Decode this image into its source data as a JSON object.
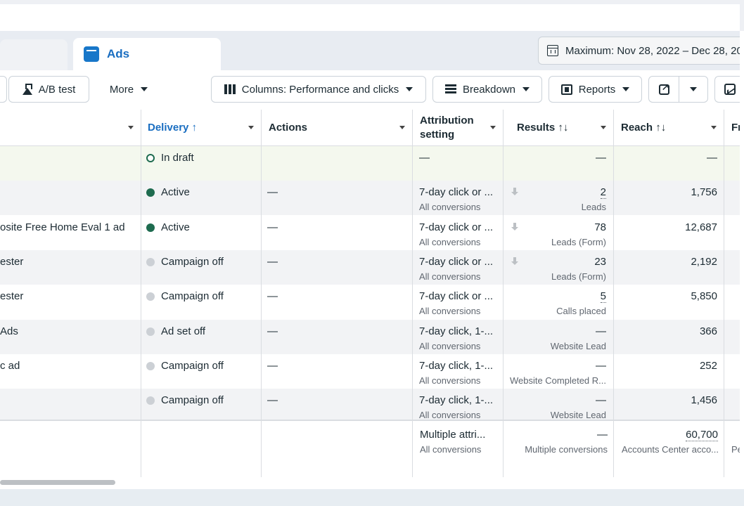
{
  "tabs": {
    "active_label": "Ads"
  },
  "date_range": {
    "label": "Maximum: Nov 28, 2022 – Dec 28, 20"
  },
  "toolbar": {
    "ab_test": "A/B test",
    "more": "More",
    "columns": "Columns: Performance and clicks",
    "breakdown": "Breakdown",
    "reports": "Reports"
  },
  "table": {
    "headers": {
      "delivery": "Delivery ↑",
      "actions": "Actions",
      "attribution_line1": "Attribution",
      "attribution_line2": "setting",
      "results": "Results ↑↓",
      "reach": "Reach ↑↓",
      "next": "Fr"
    },
    "rows": [
      {
        "name": "",
        "delivery": "In draft",
        "status": "draft",
        "actions": "",
        "attribution": "—",
        "attribution_sub": "",
        "results": "—",
        "results_sub": "",
        "reach": "—"
      },
      {
        "name": "",
        "delivery": "Active",
        "status": "active",
        "actions": "—",
        "attribution": "7-day click or ...",
        "attribution_sub": "All conversions",
        "results": "2",
        "results_sub": "Leads",
        "reach": "1,756"
      },
      {
        "name": "osite Free Home Eval 1 ad",
        "delivery": "Active",
        "status": "active",
        "actions": "—",
        "attribution": "7-day click or ...",
        "attribution_sub": "All conversions",
        "results": "78",
        "results_sub": "Leads (Form)",
        "reach": "12,687"
      },
      {
        "name": "ester",
        "delivery": "Campaign off",
        "status": "off",
        "actions": "—",
        "attribution": "7-day click or ...",
        "attribution_sub": "All conversions",
        "results": "23",
        "results_sub": "Leads (Form)",
        "reach": "2,192"
      },
      {
        "name": "ester",
        "delivery": "Campaign off",
        "status": "off",
        "actions": "—",
        "attribution": "7-day click or ...",
        "attribution_sub": "All conversions",
        "results": "5",
        "results_sub": "Calls placed",
        "reach": "5,850"
      },
      {
        "name": "Ads",
        "delivery": "Ad set off",
        "status": "off",
        "actions": "—",
        "attribution": "7-day click, 1-...",
        "attribution_sub": "All conversions",
        "results": "—",
        "results_sub": "Website Lead",
        "reach": "366"
      },
      {
        "name": "c ad",
        "delivery": "Campaign off",
        "status": "off",
        "actions": "—",
        "attribution": "7-day click, 1-...",
        "attribution_sub": "All conversions",
        "results": "—",
        "results_sub": "Website Completed R...",
        "reach": "252"
      },
      {
        "name": "",
        "delivery": "Campaign off",
        "status": "off",
        "actions": "—",
        "attribution": "7-day click, 1-...",
        "attribution_sub": "All conversions",
        "results": "—",
        "results_sub": "Website Lead",
        "reach": "1,456"
      }
    ],
    "totals": {
      "attribution": "Multiple attri...",
      "attribution_sub": "All conversions",
      "results": "—",
      "results_sub": "Multiple conversions",
      "reach": "60,700",
      "reach_sub": "Accounts Center acco...",
      "next_sub": "Pe"
    }
  }
}
